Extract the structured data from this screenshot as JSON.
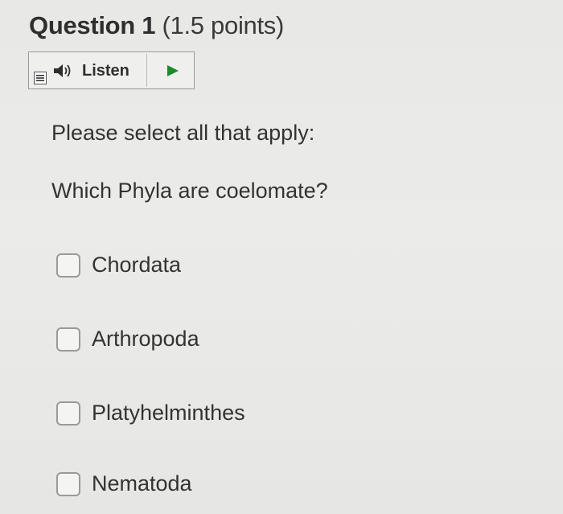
{
  "question": {
    "title": "Question 1",
    "points": "(1.5 points)"
  },
  "listen": {
    "label": "Listen",
    "menu_icon": "menu-icon",
    "speaker_icon": "speaker-icon",
    "play_icon": "play-icon"
  },
  "content": {
    "instruction": "Please select all that apply:",
    "prompt": "Which Phyla are coelomate?"
  },
  "options": [
    {
      "label": "Chordata",
      "checked": false
    },
    {
      "label": "Arthropoda",
      "checked": false
    },
    {
      "label": "Platyhelminthes",
      "checked": false
    },
    {
      "label": "Nematoda",
      "checked": false
    }
  ]
}
